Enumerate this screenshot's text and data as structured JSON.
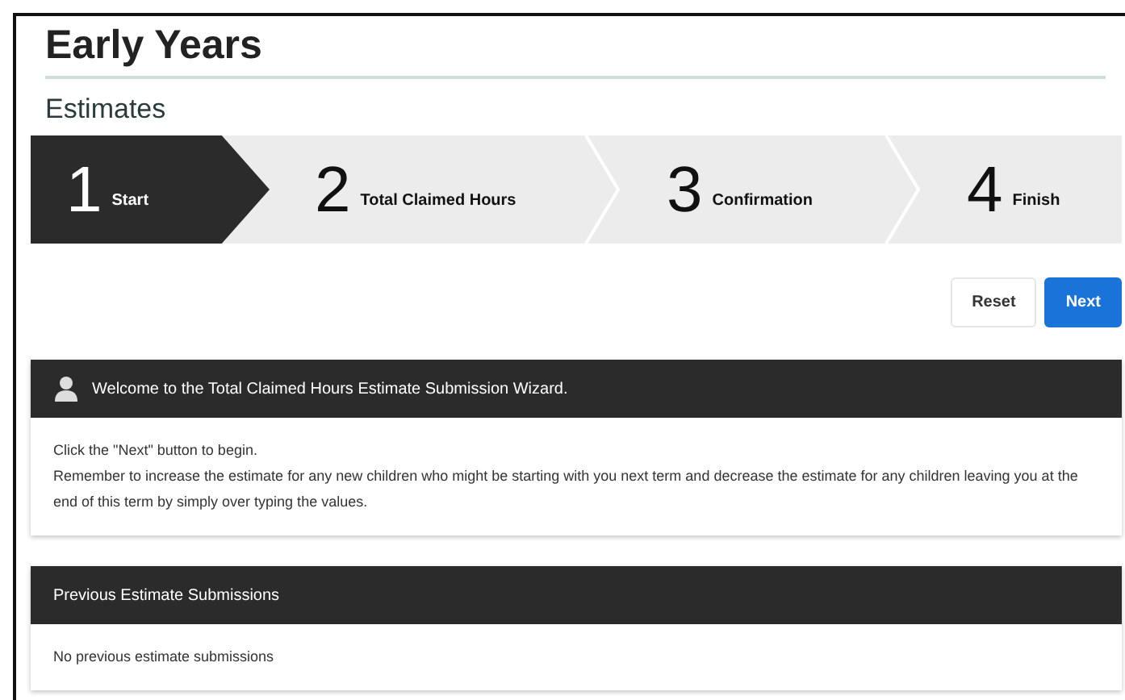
{
  "page": {
    "title": "Early Years",
    "subtitle": "Estimates"
  },
  "steps": [
    {
      "number": "1",
      "label": "Start",
      "selected": true
    },
    {
      "number": "2",
      "label": "Total Claimed Hours",
      "selected": false
    },
    {
      "number": "3",
      "label": "Confirmation",
      "selected": false
    },
    {
      "number": "4",
      "label": "Finish",
      "selected": false
    }
  ],
  "buttons": [
    {
      "label": "Reset",
      "kind": "secondary"
    },
    {
      "label": "Next",
      "kind": "primary"
    }
  ],
  "panels": [
    {
      "title": "Welcome to the Total Claimed Hours Estimate Submission Wizard.",
      "icon": true,
      "lines": [
        "Click the \"Next\" button to begin.",
        "Remember to increase the estimate for any new children who might be starting with you next term and decrease the estimate for any children leaving you at the end of this term by simply over typing the values."
      ]
    },
    {
      "title": "Previous Estimate Submissions",
      "icon": false,
      "lines": [
        "No previous estimate submissions"
      ]
    }
  ]
}
